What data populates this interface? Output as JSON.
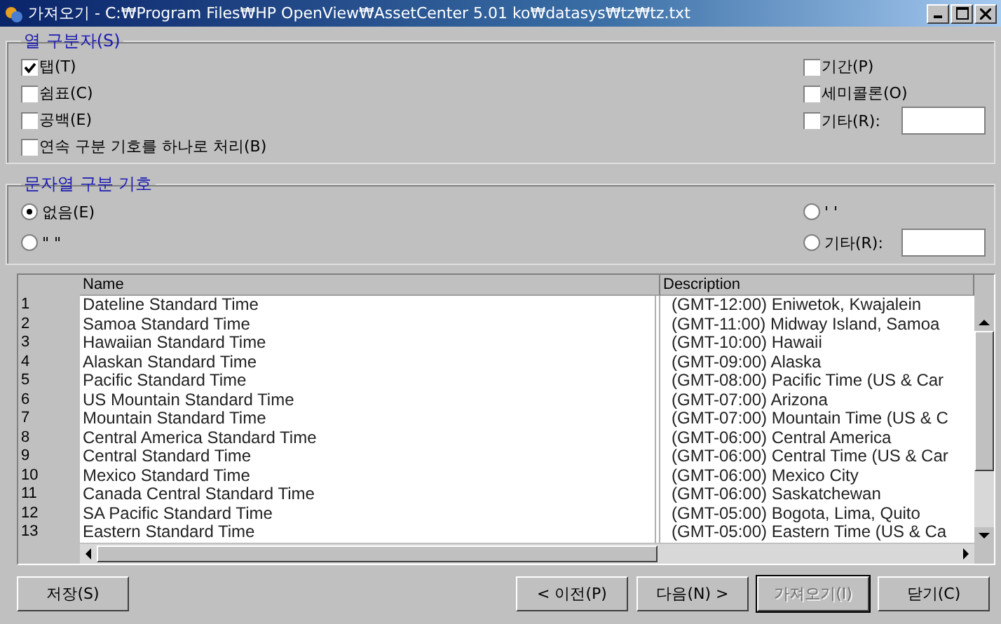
{
  "window": {
    "title": "가져오기 - C:₩Program Files₩HP OpenView₩AssetCenter 5.01 ko₩datasys₩tz₩tz.txt"
  },
  "column_separators": {
    "legend": "열 구분자(S)",
    "left_options": [
      {
        "label": "탭(T)",
        "checked": true
      },
      {
        "label": "쉼표(C)",
        "checked": false
      },
      {
        "label": "공백(E)",
        "checked": false
      },
      {
        "label": "연속 구분 기호를 하나로 처리(B)",
        "checked": false
      }
    ],
    "right_options": [
      {
        "label": "기간(P)",
        "checked": false
      },
      {
        "label": "세미콜론(O)",
        "checked": false
      },
      {
        "label": "기타(R):",
        "checked": false,
        "kind": "with_field"
      }
    ]
  },
  "string_delimiter": {
    "legend": "문자열 구분 기호",
    "left_options": [
      {
        "label": "없음(E)",
        "selected": true
      },
      {
        "label": "\" \"",
        "selected": false
      }
    ],
    "right_options": [
      {
        "label": "' '",
        "selected": false
      },
      {
        "label": "기타(R):",
        "selected": false,
        "kind": "with_field"
      }
    ]
  },
  "table": {
    "columns": [
      {
        "label": "Name"
      },
      {
        "label": "Description"
      }
    ],
    "rows": [
      {
        "number": "1",
        "name": "Dateline Standard Time",
        "description": "(GMT-12:00) Eniwetok, Kwajalein"
      },
      {
        "number": "2",
        "name": "Samoa Standard Time",
        "description": "(GMT-11:00) Midway Island, Samoa"
      },
      {
        "number": "3",
        "name": "Hawaiian Standard Time",
        "description": "(GMT-10:00) Hawaii"
      },
      {
        "number": "4",
        "name": "Alaskan Standard Time",
        "description": "(GMT-09:00) Alaska"
      },
      {
        "number": "5",
        "name": "Pacific Standard Time",
        "description": "(GMT-08:00) Pacific Time (US & Car"
      },
      {
        "number": "6",
        "name": "US Mountain Standard Time",
        "description": "(GMT-07:00) Arizona"
      },
      {
        "number": "7",
        "name": "Mountain Standard Time",
        "description": "(GMT-07:00) Mountain Time (US & C"
      },
      {
        "number": "8",
        "name": "Central America Standard Time",
        "description": "(GMT-06:00) Central America"
      },
      {
        "number": "9",
        "name": "Central Standard Time",
        "description": "(GMT-06:00) Central Time (US & Car"
      },
      {
        "number": "10",
        "name": "Mexico Standard Time",
        "description": "(GMT-06:00) Mexico City"
      },
      {
        "number": "11",
        "name": "Canada Central Standard Time",
        "description": "(GMT-06:00) Saskatchewan"
      },
      {
        "number": "12",
        "name": "SA Pacific Standard Time",
        "description": "(GMT-05:00) Bogota, Lima, Quito"
      },
      {
        "number": "13",
        "name": "Eastern Standard Time",
        "description": "(GMT-05:00) Eastern Time (US & Ca"
      }
    ]
  },
  "buttons_left": [
    {
      "label": "저장(S)",
      "disabled": false
    }
  ],
  "buttons_right": [
    {
      "label": "< 이전(P)",
      "disabled": false
    },
    {
      "label": "다음(N) >",
      "disabled": false
    },
    {
      "label": "가져오기(I)",
      "disabled": true
    },
    {
      "label": "닫기(C)",
      "disabled": false
    }
  ]
}
